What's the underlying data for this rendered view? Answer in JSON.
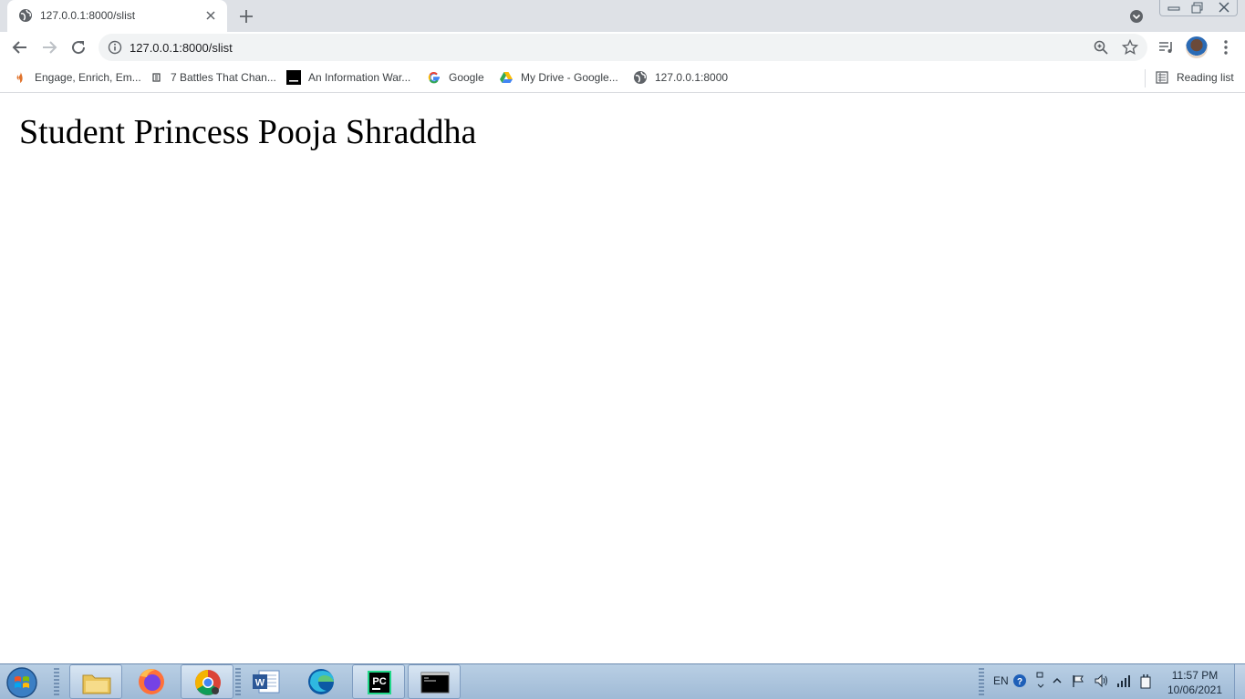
{
  "browser": {
    "tab": {
      "title": "127.0.0.1:8000/slist",
      "favicon": "globe-icon"
    },
    "address": {
      "url": "127.0.0.1:8000/slist"
    },
    "bookmarks": [
      {
        "label": "Engage, Enrich, Em...",
        "icon": "flame-icon"
      },
      {
        "label": "7 Battles That Chan...",
        "icon": "book-icon"
      },
      {
        "label": "An Information War...",
        "icon": "medium-icon"
      },
      {
        "label": "Google",
        "icon": "google-icon"
      },
      {
        "label": "My Drive - Google...",
        "icon": "drive-icon"
      },
      {
        "label": "127.0.0.1:8000",
        "icon": "globe-icon"
      }
    ],
    "reading_list": "Reading list"
  },
  "page": {
    "heading": "Student Princess Pooja Shraddha"
  },
  "taskbar": {
    "language": "EN",
    "time": "11:57 PM",
    "date": "10/06/2021"
  }
}
